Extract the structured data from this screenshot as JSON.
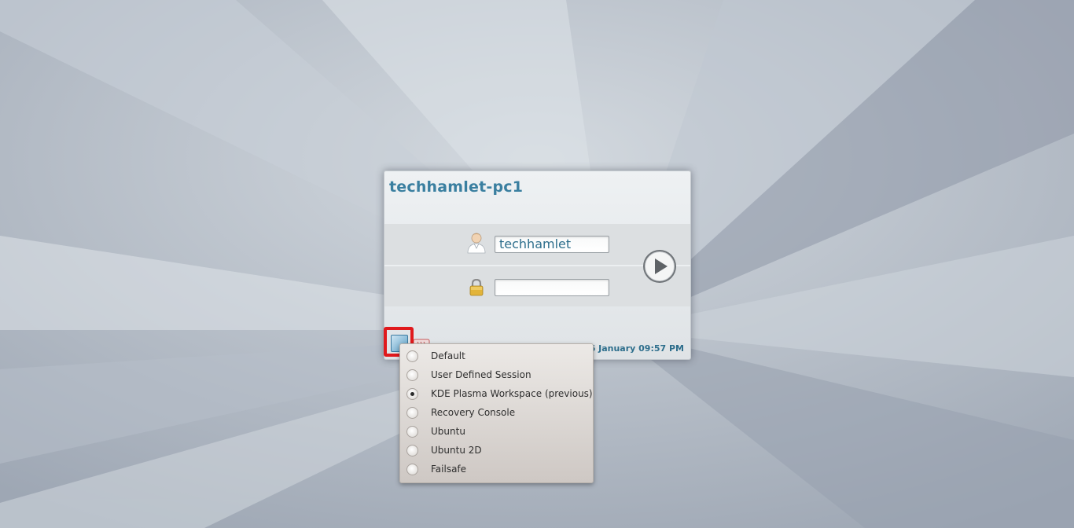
{
  "login": {
    "hostname": "techhamlet-pc1",
    "username_value": "techhamlet",
    "password_value": "",
    "datetime": "6 January 09:57 PM"
  },
  "session_menu": {
    "items": [
      {
        "label": "Default",
        "checked": false
      },
      {
        "label": "User Defined Session",
        "checked": false
      },
      {
        "label": "KDE Plasma Workspace (previous)",
        "checked": true
      },
      {
        "label": "Recovery Console",
        "checked": false
      },
      {
        "label": "Ubuntu",
        "checked": false
      },
      {
        "label": "Ubuntu 2D",
        "checked": false
      },
      {
        "label": "Failsafe",
        "checked": false
      }
    ]
  },
  "colors": {
    "accent_text": "#2d6e8c",
    "hostname_text": "#3a7fa0",
    "highlight_box": "#e0191c"
  },
  "icons": {
    "user": "user-icon",
    "password": "lock-icon",
    "login": "play-arrow-icon",
    "session": "session-menu-icon",
    "shutdown": "shutdown-icon"
  }
}
